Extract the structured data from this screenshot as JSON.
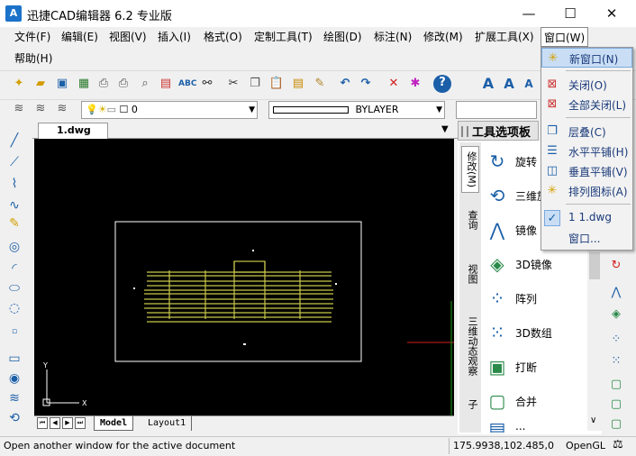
{
  "title": "迅捷CAD编辑器 6.2 专业版",
  "app_icon_text": "A",
  "window_controls": {
    "minimize": "—",
    "maximize": "☐",
    "close": "✕"
  },
  "menu": [
    "文件(F)",
    "编辑(E)",
    "视图(V)",
    "插入(I)",
    "格式(O)",
    "定制工具(T)",
    "绘图(D)",
    "标注(N)",
    "修改(M)",
    "扩展工具(X)",
    "窗口(W)",
    "帮助(H)"
  ],
  "layer": {
    "value": "0"
  },
  "linetype": {
    "value": "BYLAYER"
  },
  "document_tab": {
    "label": "1.dwg",
    "close": "✕"
  },
  "layout_tabs": [
    "Model",
    "Layout1"
  ],
  "palette": {
    "title": "工具选项板",
    "vertical_tabs": [
      "修改(M)",
      "查询",
      "视图",
      "三维动态观察",
      "子"
    ],
    "tools": [
      "旋转",
      "三维旋转",
      "镜像",
      "3D镜像",
      "阵列",
      "3D数组",
      "打断",
      "合并",
      "..."
    ]
  },
  "window_menu": {
    "items": [
      {
        "label": "新窗口(N)",
        "icon": "new-window-icon",
        "highlighted": true
      },
      {
        "label": "关闭(O)",
        "icon": "close-window-icon"
      },
      {
        "label": "全部关闭(L)",
        "icon": "close-all-icon"
      },
      {
        "label": "层叠(C)",
        "icon": "cascade-icon"
      },
      {
        "label": "水平平铺(H)",
        "icon": "tile-horizontal-icon"
      },
      {
        "label": "垂直平铺(V)",
        "icon": "tile-vertical-icon"
      },
      {
        "label": "排列图标(A)",
        "icon": "arrange-icons-icon"
      },
      {
        "label": "1 1.dwg",
        "icon": "checkmark-icon",
        "checked": true
      },
      {
        "label": "窗口...",
        "icon": ""
      }
    ]
  },
  "axis": {
    "y": "Y",
    "x": "X"
  },
  "status": {
    "message": "Open another window for the active document",
    "coords": "175.9938,102.485,0",
    "render": "OpenGL"
  },
  "colors": {
    "accent": "#1b73c9",
    "canvas": "#000000",
    "drawing": "#c8c84a",
    "highlight": "#c9def5"
  }
}
